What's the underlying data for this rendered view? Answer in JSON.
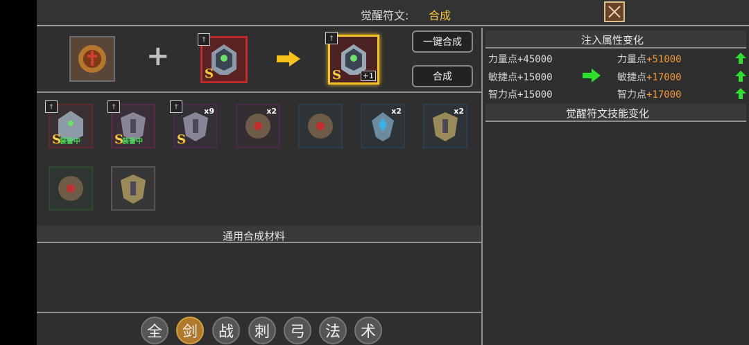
{
  "header": {
    "title_label": "觉醒符文:",
    "title_value": "合成"
  },
  "actions": {
    "one_click_label": "一键合成",
    "combine_label": "合成"
  },
  "slots": {
    "source_s": "S",
    "target_s": "S",
    "target_level": "+1"
  },
  "inventory": [
    {
      "s": "S",
      "status": "装备中",
      "qty": ""
    },
    {
      "s": "S",
      "status": "装备中",
      "qty": ""
    },
    {
      "s": "S",
      "status": "",
      "qty": "x9"
    },
    {
      "s": "",
      "status": "",
      "qty": "x2"
    },
    {
      "s": "",
      "status": "",
      "qty": ""
    },
    {
      "s": "",
      "status": "",
      "qty": "x2"
    },
    {
      "s": "",
      "status": "",
      "qty": "x2"
    },
    {
      "s": "",
      "status": "",
      "qty": ""
    },
    {
      "s": "",
      "status": "",
      "qty": ""
    }
  ],
  "materials": {
    "title": "通用合成材料"
  },
  "tabs": [
    "全",
    "剑",
    "战",
    "刺",
    "弓",
    "法",
    "术"
  ],
  "active_tab": "剑",
  "attributes": {
    "title": "注入属性变化",
    "old": [
      {
        "label": "力量点",
        "value": "+45000"
      },
      {
        "label": "敏捷点",
        "value": "+15000"
      },
      {
        "label": "智力点",
        "value": "+15000"
      }
    ],
    "new": [
      {
        "label": "力量点",
        "value": "+51000"
      },
      {
        "label": "敏捷点",
        "value": "+17000"
      },
      {
        "label": "智力点",
        "value": "+17000"
      }
    ]
  },
  "skills": {
    "title": "觉醒符文技能变化"
  },
  "colors": {
    "accent": "#f3c53f",
    "up_arrow": "#2fe02f",
    "new_value": "#f29a3a"
  }
}
